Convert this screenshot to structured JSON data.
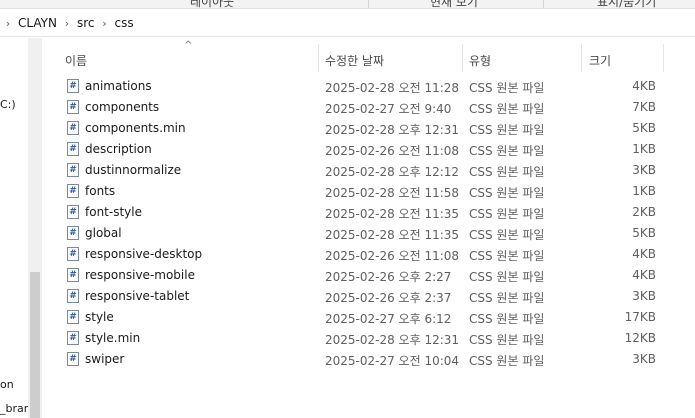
{
  "ribbon": {
    "items": [
      "레이아웃",
      "현재 보기",
      "표시/숨기기"
    ]
  },
  "address": {
    "path": [
      "CLAYN",
      "src",
      "css"
    ]
  },
  "nav": {
    "items": [
      "C:)",
      "on",
      "_bran"
    ]
  },
  "columns": {
    "name": "이름",
    "date": "수정한 날짜",
    "type": "유형",
    "size": "크기"
  },
  "file_icon_glyph": "#",
  "files": [
    {
      "name": "animations",
      "date": "2025-02-28 오전 11:28",
      "type": "CSS 원본 파일",
      "size": "4KB"
    },
    {
      "name": "components",
      "date": "2025-02-27 오전 9:40",
      "type": "CSS 원본 파일",
      "size": "7KB"
    },
    {
      "name": "components.min",
      "date": "2025-02-28 오후 12:31",
      "type": "CSS 원본 파일",
      "size": "5KB"
    },
    {
      "name": "description",
      "date": "2025-02-26 오전 11:08",
      "type": "CSS 원본 파일",
      "size": "1KB"
    },
    {
      "name": "dustinnormalize",
      "date": "2025-02-28 오후 12:12",
      "type": "CSS 원본 파일",
      "size": "3KB"
    },
    {
      "name": "fonts",
      "date": "2025-02-28 오전 11:58",
      "type": "CSS 원본 파일",
      "size": "1KB"
    },
    {
      "name": "font-style",
      "date": "2025-02-28 오전 11:35",
      "type": "CSS 원본 파일",
      "size": "2KB"
    },
    {
      "name": "global",
      "date": "2025-02-28 오전 11:35",
      "type": "CSS 원본 파일",
      "size": "5KB"
    },
    {
      "name": "responsive-desktop",
      "date": "2025-02-26 오전 11:08",
      "type": "CSS 원본 파일",
      "size": "4KB"
    },
    {
      "name": "responsive-mobile",
      "date": "2025-02-26 오후 2:27",
      "type": "CSS 원본 파일",
      "size": "4KB"
    },
    {
      "name": "responsive-tablet",
      "date": "2025-02-26 오후 2:37",
      "type": "CSS 원본 파일",
      "size": "3KB"
    },
    {
      "name": "style",
      "date": "2025-02-27 오후 6:12",
      "type": "CSS 원본 파일",
      "size": "17KB"
    },
    {
      "name": "style.min",
      "date": "2025-02-28 오후 12:31",
      "type": "CSS 원본 파일",
      "size": "12KB"
    },
    {
      "name": "swiper",
      "date": "2025-02-27 오전 10:04",
      "type": "CSS 원본 파일",
      "size": "3KB"
    }
  ]
}
